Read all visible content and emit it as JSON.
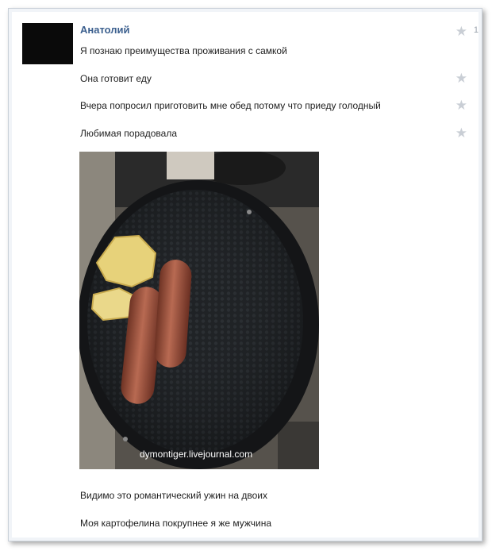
{
  "post": {
    "author": "Анатолий",
    "like_count": "1",
    "messages": [
      "Я познаю преимущества проживания с самкой",
      "Она готовит еду",
      "Вчера попросил приготовить мне обед потому что приеду голодный",
      "Любимая порадовала",
      "Видимо это романтический ужин на двоих",
      "Моя картофелина покрупнее я же мужчина"
    ],
    "photo_watermark": "dymontiger.livejournal.com"
  },
  "icons": {
    "like": "star-icon"
  },
  "colors": {
    "author": "#3b5f8e",
    "background": "#f1f4f8",
    "star": "#c9ced5"
  }
}
